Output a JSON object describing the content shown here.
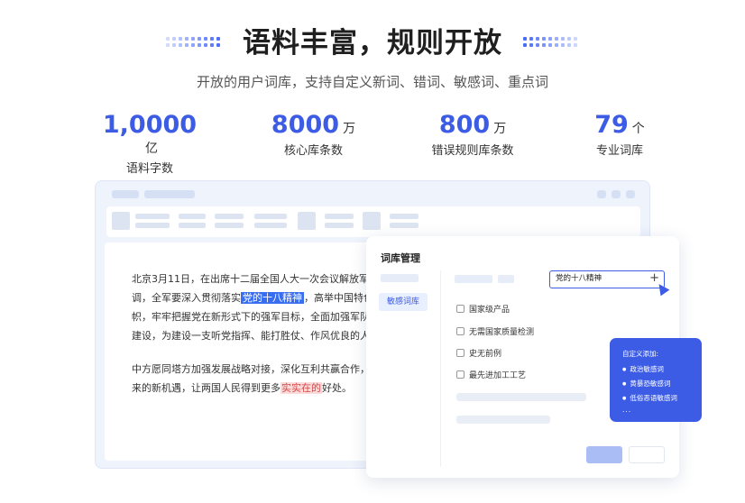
{
  "header": {
    "title": "语料丰富，规则开放",
    "subtitle": "开放的用户词库，支持自定义新词、错词、敏感词、重点词"
  },
  "stats": [
    {
      "value": "1,0000",
      "unit": "亿",
      "label": "语料字数"
    },
    {
      "value": "8000",
      "unit": "万",
      "label": "核心库条数"
    },
    {
      "value": "800",
      "unit": "万",
      "label": "错误规则库条数"
    },
    {
      "value": "79",
      "unit": "个",
      "label": "专业词库"
    }
  ],
  "document": {
    "p1_l1": "北京3月11日，在出席十二届全国人大一次会议解放军",
    "p1_l2_a": "调，全军要深入贯彻落实",
    "p1_l2_hl": "党的十八精神",
    "p1_l2_b": "，高举中国特色",
    "p1_l3": "帜，牢牢把握党在新形式下的强军目标，全面加强军队",
    "p1_l4": "建设，为建设一支听党指挥、能打胜仗、作风优良的人",
    "p2_l1": "中方愿同塔方加强发展战略对接，深化互利共赢合作，",
    "p2_l2_a": "来的新机遇，让两国人民得到更多",
    "p2_l2_hl": "实实在的",
    "p2_l2_b": "好处。"
  },
  "panel": {
    "title": "词库管理",
    "side_item": "敏感词库",
    "search_value": "党的十八精神",
    "add_icon": "+",
    "checkboxes": [
      "国家级产品",
      "无需国家质量检测",
      "史无前例",
      "最先进加工工艺"
    ]
  },
  "popup": {
    "title": "自定义添加:",
    "items": [
      "政治敏感词",
      "黄暴恐敏感词",
      "低俗恶语敏感词"
    ],
    "more": "..."
  },
  "colors": {
    "accent": "#3d5ce6",
    "highlight_pink": "#fbdada"
  }
}
